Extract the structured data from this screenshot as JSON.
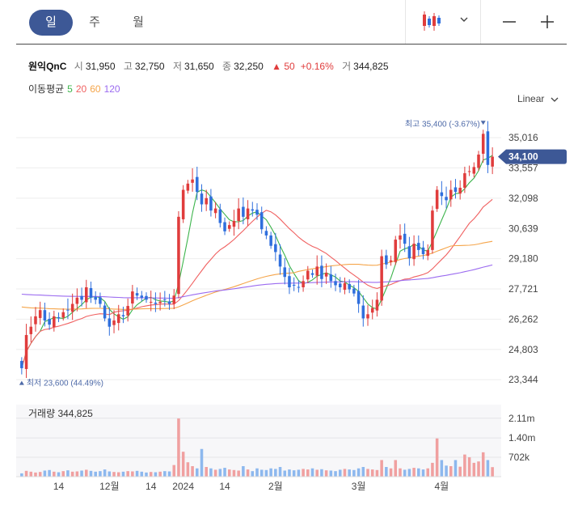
{
  "toolbar": {
    "tabs": [
      {
        "label": "일",
        "active": true
      },
      {
        "label": "주",
        "active": false
      },
      {
        "label": "월",
        "active": false
      }
    ],
    "chart_type_icon": "candlestick-icon",
    "dropdown_icon": "chevron-down-icon",
    "zoom_out_icon": "minus-icon",
    "zoom_in_icon": "plus-icon"
  },
  "quote": {
    "name": "원익QnC",
    "open_label": "시",
    "open": "31,950",
    "high_label": "고",
    "high": "32,750",
    "low_label": "저",
    "low": "31,650",
    "close_label": "종",
    "close": "32,250",
    "change": "▲ 50",
    "change_pct": "+0.16%",
    "volume_label": "거",
    "volume": "344,825"
  },
  "moving_average": {
    "label": "이동평균",
    "periods": [
      {
        "label": "5",
        "color": "#3cb44b"
      },
      {
        "label": "20",
        "color": "#f06060"
      },
      {
        "label": "60",
        "color": "#f5a54a"
      },
      {
        "label": "120",
        "color": "#9b6bf0"
      }
    ]
  },
  "scale_selector": {
    "label": "Linear",
    "icon": "chevron-down-icon"
  },
  "colors": {
    "up": "#e03c3c",
    "down": "#2f6fdd",
    "accent": "#3d5896",
    "up_volume": "#f0a0a0",
    "down_volume": "#8db8ee"
  },
  "chart_data": {
    "type": "candlestick",
    "y_ticks": [
      "35,016",
      "33,557",
      "32,098",
      "30,639",
      "29,180",
      "27,721",
      "26,262",
      "24,803",
      "23,344"
    ],
    "ylim": [
      23000,
      35800
    ],
    "current_price_label": "34,100",
    "current_price": 34100,
    "max_label": "최고 35,400 (-3.67%)",
    "max_price": 35400,
    "min_label": "최저 23,600 (44.49%)",
    "min_price": 23600,
    "x_tick_labels": [
      {
        "label": "14",
        "index": 8
      },
      {
        "label": "12월",
        "index": 19
      },
      {
        "label": "14",
        "index": 28
      },
      {
        "label": "2024",
        "index": 35
      },
      {
        "label": "14",
        "index": 44
      },
      {
        "label": "2월",
        "index": 55
      },
      {
        "label": "3월",
        "index": 73
      },
      {
        "label": "4월",
        "index": 91
      }
    ],
    "volume_label": "거래량",
    "volume_value": "344,825",
    "volume_ticks": [
      "2.11m",
      "1.40m",
      "702k"
    ],
    "volume_tick_values": [
      2110000,
      1400000,
      702000
    ],
    "volume_max": 2600000,
    "closes": [
      23900,
      25500,
      25900,
      26400,
      26700,
      26200,
      26000,
      26400,
      26300,
      26600,
      26700,
      27000,
      27300,
      27200,
      27800,
      27300,
      27200,
      27000,
      26300,
      25900,
      26200,
      26500,
      26400,
      26900,
      27600,
      27400,
      27300,
      27200,
      27100,
      27000,
      27100,
      27200,
      27000,
      27400,
      31200,
      32500,
      32800,
      33000,
      32400,
      31800,
      32100,
      31500,
      31600,
      30900,
      30500,
      30800,
      31000,
      31600,
      31200,
      31600,
      31500,
      31300,
      30600,
      30300,
      29800,
      29500,
      28800,
      28300,
      27800,
      27900,
      27800,
      28100,
      28600,
      28400,
      28800,
      28200,
      28500,
      28100,
      27900,
      27800,
      28000,
      27700,
      27500,
      27000,
      26300,
      26500,
      26800,
      27200,
      29300,
      28900,
      29100,
      30100,
      30300,
      29900,
      29200,
      29900,
      29600,
      29400,
      29600,
      31500,
      32500,
      32200,
      32000,
      32500,
      32400,
      32600,
      33300,
      33400,
      33600,
      34200,
      35200,
      33700,
      34100
    ],
    "volumes": [
      120000,
      210000,
      180000,
      150000,
      170000,
      220000,
      240000,
      180000,
      160000,
      200000,
      230000,
      180000,
      190000,
      220000,
      250000,
      210000,
      180000,
      200000,
      260000,
      190000,
      170000,
      160000,
      180000,
      200000,
      190000,
      210000,
      180000,
      150000,
      170000,
      160000,
      180000,
      200000,
      190000,
      420000,
      2100000,
      900000,
      520000,
      380000,
      300000,
      1000000,
      350000,
      300000,
      250000,
      280000,
      320000,
      260000,
      240000,
      220000,
      380000,
      260000,
      200000,
      300000,
      250000,
      240000,
      300000,
      280000,
      350000,
      220000,
      260000,
      230000,
      250000,
      280000,
      260000,
      300000,
      250000,
      270000,
      230000,
      220000,
      200000,
      250000,
      280000,
      260000,
      240000,
      300000,
      350000,
      280000,
      260000,
      240000,
      600000,
      350000,
      300000,
      600000,
      300000,
      250000,
      280000,
      320000,
      300000,
      260000,
      300000,
      500000,
      1380000,
      600000,
      400000,
      380000,
      600000,
      360000,
      800000,
      700000,
      500000,
      550000,
      880000,
      600000,
      344825
    ]
  }
}
